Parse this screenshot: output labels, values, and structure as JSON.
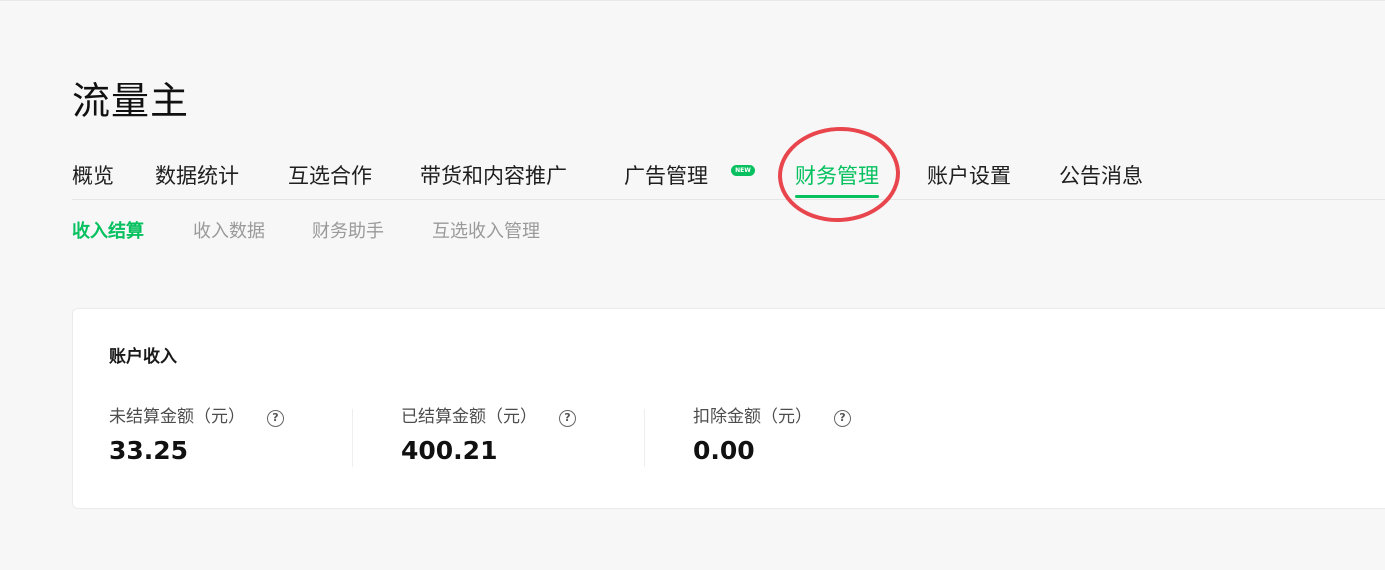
{
  "page": {
    "title": "流量主"
  },
  "nav": {
    "items": [
      {
        "label": "概览"
      },
      {
        "label": "数据统计"
      },
      {
        "label": "互选合作"
      },
      {
        "label": "带货和内容推广"
      },
      {
        "label": "广告管理",
        "badge": "NEW"
      },
      {
        "label": "财务管理",
        "active": true
      },
      {
        "label": "账户设置"
      },
      {
        "label": "公告消息"
      }
    ]
  },
  "subnav": {
    "items": [
      {
        "label": "收入结算",
        "active": true
      },
      {
        "label": "收入数据"
      },
      {
        "label": "财务助手"
      },
      {
        "label": "互选收入管理"
      }
    ]
  },
  "account_income": {
    "title": "账户收入",
    "stats": [
      {
        "label": "未结算金额（元）",
        "value": "33.25"
      },
      {
        "label": "已结算金额（元）",
        "value": "400.21"
      },
      {
        "label": "扣除金额（元）",
        "value": "0.00"
      }
    ]
  },
  "icons": {
    "help": "question-circle-icon"
  },
  "colors": {
    "accent": "#07c160",
    "annotation": "#e8454d"
  }
}
